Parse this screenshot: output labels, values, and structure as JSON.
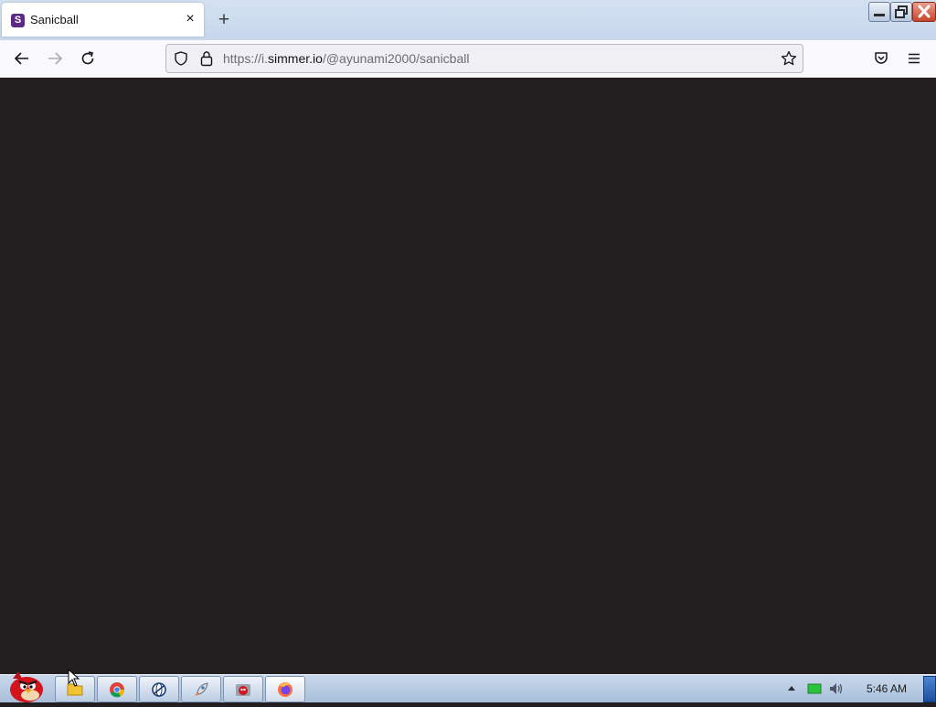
{
  "browser": {
    "tab": {
      "favicon_letter": "S",
      "title": "Sanicball",
      "close_glyph": "×"
    },
    "new_tab_glyph": "+",
    "url": {
      "prefix": "https://i.",
      "host": "simmer.io",
      "path": "/@ayunami2000/sanicball"
    },
    "icons": {
      "back": "back-arrow-icon",
      "forward": "forward-arrow-icon",
      "reload": "reload-icon",
      "shield": "tracking-protection-shield-icon",
      "lock": "padlock-icon",
      "bookmark": "star-icon",
      "pocket": "pocket-icon",
      "menu": "hamburger-menu-icon"
    },
    "content_background": "#231f20"
  },
  "taskbar": {
    "apps": [
      {
        "name": "explorer-folder",
        "icon": "folder-icon"
      },
      {
        "name": "chrome",
        "icon": "chrome-icon"
      },
      {
        "name": "network-app",
        "icon": "globe-icon"
      },
      {
        "name": "launcher",
        "icon": "rocket-icon"
      },
      {
        "name": "angry-app",
        "icon": "red-bird-icon"
      },
      {
        "name": "firefox",
        "icon": "firefox-icon"
      }
    ],
    "clock": "5:46 AM"
  }
}
